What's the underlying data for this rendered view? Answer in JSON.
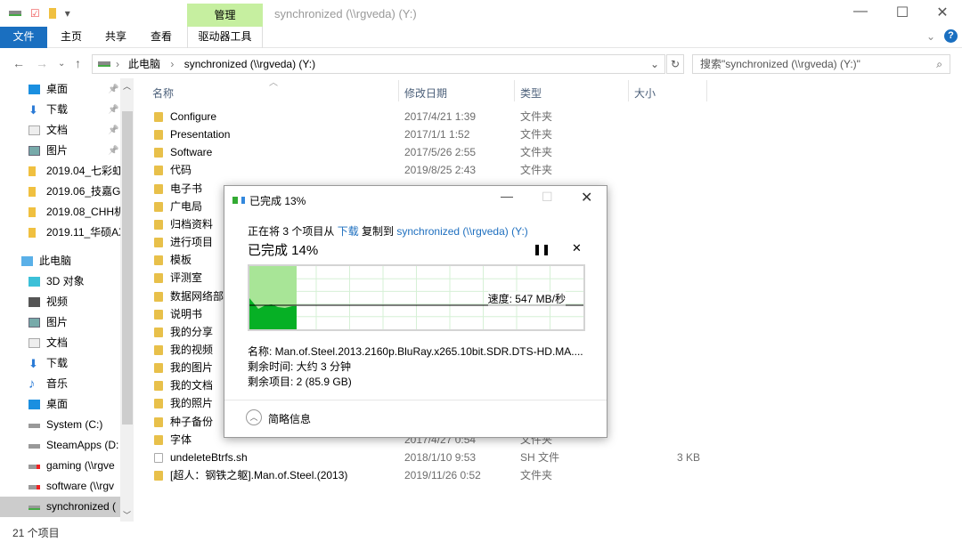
{
  "window": {
    "title": "synchronized (\\\\rgveda) (Y:)",
    "context_tab": "管理"
  },
  "ribbon": {
    "tabs": [
      "文件",
      "主页",
      "共享",
      "查看",
      "驱动器工具"
    ]
  },
  "address": {
    "crumbs": [
      "此电脑",
      "synchronized (\\\\rgveda) (Y:)"
    ]
  },
  "search": {
    "placeholder": "搜索\"synchronized (\\\\rgveda) (Y:)\""
  },
  "sidebar": {
    "items": [
      {
        "label": "桌面",
        "icon": "desktop-icon",
        "pinned": true
      },
      {
        "label": "下载",
        "icon": "download-icon",
        "pinned": true
      },
      {
        "label": "文档",
        "icon": "document-icon",
        "pinned": true
      },
      {
        "label": "图片",
        "icon": "picture-icon",
        "pinned": true
      },
      {
        "label": "2019.04_七彩虹",
        "icon": "folder-icon"
      },
      {
        "label": "2019.06_技嘉GT",
        "icon": "folder-icon"
      },
      {
        "label": "2019.08_CHH机",
        "icon": "folder-icon"
      },
      {
        "label": "2019.11_华硕AX",
        "icon": "folder-icon"
      },
      {
        "label": "此电脑",
        "icon": "computer-icon"
      },
      {
        "label": "3D 对象",
        "icon": "3d-icon"
      },
      {
        "label": "视频",
        "icon": "video-icon"
      },
      {
        "label": "图片",
        "icon": "picture-icon"
      },
      {
        "label": "文档",
        "icon": "document-icon"
      },
      {
        "label": "下载",
        "icon": "download-icon"
      },
      {
        "label": "音乐",
        "icon": "music-icon"
      },
      {
        "label": "桌面",
        "icon": "desktop-icon"
      },
      {
        "label": "System (C:)",
        "icon": "drive-icon"
      },
      {
        "label": "SteamApps (D:",
        "icon": "drive-icon"
      },
      {
        "label": "gaming (\\\\rgve",
        "icon": "network-drive-disconnected-icon"
      },
      {
        "label": "software (\\\\rgv",
        "icon": "network-drive-disconnected-icon"
      },
      {
        "label": "synchronized (",
        "icon": "network-drive-icon",
        "selected": true
      }
    ]
  },
  "columns": {
    "name": "名称",
    "date": "修改日期",
    "type": "类型",
    "size": "大小"
  },
  "files": [
    {
      "name": "Configure",
      "date": "2017/4/21 1:39",
      "type": "文件夹"
    },
    {
      "name": "Presentation",
      "date": "2017/1/1 1:52",
      "type": "文件夹"
    },
    {
      "name": "Software",
      "date": "2017/5/26 2:55",
      "type": "文件夹"
    },
    {
      "name": "代码",
      "date": "2019/8/25 2:43",
      "type": "文件夹"
    },
    {
      "name": "电子书"
    },
    {
      "name": "广电局"
    },
    {
      "name": "归档资料"
    },
    {
      "name": "进行项目"
    },
    {
      "name": "模板"
    },
    {
      "name": "评测室"
    },
    {
      "name": "数据网络部"
    },
    {
      "name": "说明书"
    },
    {
      "name": "我的分享"
    },
    {
      "name": "我的视频"
    },
    {
      "name": "我的图片"
    },
    {
      "name": "我的文档"
    },
    {
      "name": "我的照片"
    },
    {
      "name": "种子备份"
    },
    {
      "name": "字体",
      "date": "2017/4/27 0:54",
      "type": "文件夹"
    },
    {
      "name": "undeleteBtrfs.sh",
      "date": "2018/1/10 9:53",
      "type": "SH 文件",
      "size": "3 KB",
      "file": true
    },
    {
      "name": "[超人：钢铁之躯].Man.of.Steel.(2013)",
      "date": "2019/11/26 0:52",
      "type": "文件夹"
    }
  ],
  "status": {
    "count": "21 个项目"
  },
  "dialog": {
    "title": "已完成 13%",
    "desc_prefix": "正在将 3 个项目从 ",
    "source": "下载",
    "desc_mid": " 复制到 ",
    "dest": "synchronized (\\\\rgveda) (Y:)",
    "progress_label": "已完成 14%",
    "progress_percent": 14,
    "speed": "速度: 547 MB/秒",
    "name": "名称: Man.of.Steel.2013.2160p.BluRay.x265.10bit.SDR.DTS-HD.MA....",
    "time_left": "剩余时间: 大约 3 分钟",
    "items_left": "剩余项目: 2 (85.9 GB)",
    "details_toggle": "简略信息",
    "colors": {
      "done": "#06b025",
      "done_light": "#a8e597"
    }
  }
}
